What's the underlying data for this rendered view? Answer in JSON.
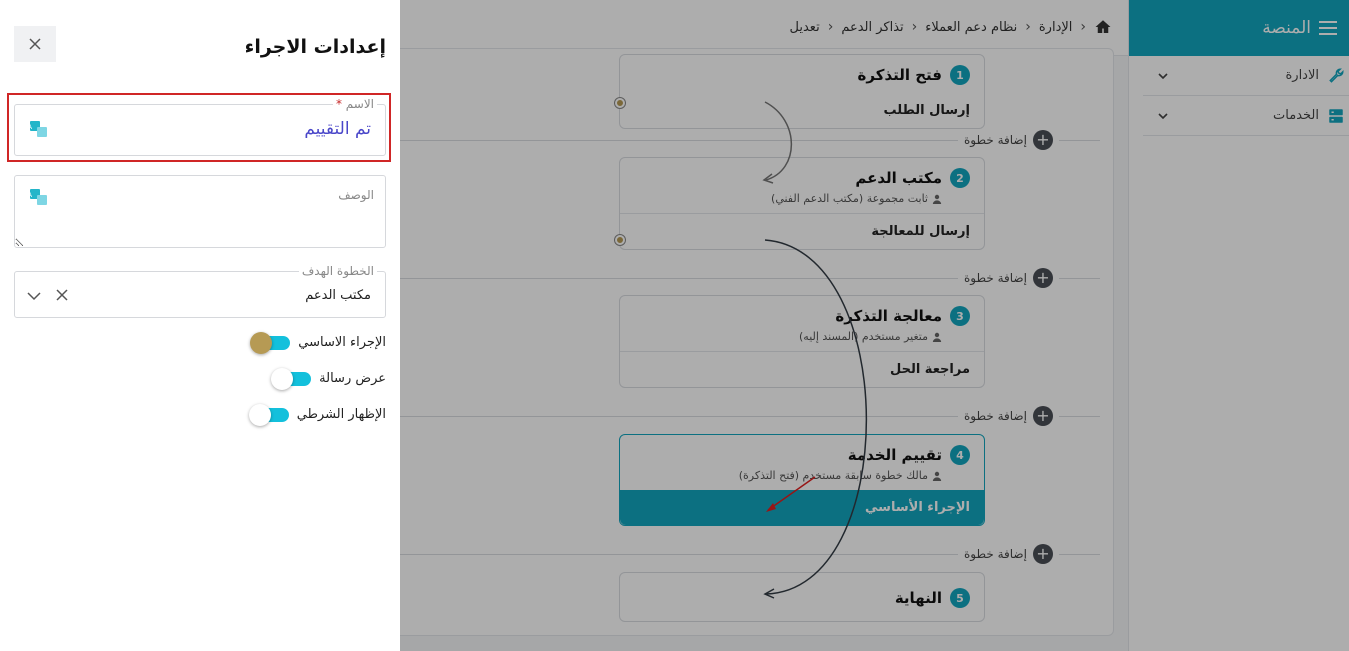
{
  "breadcrumb": {
    "items": [
      "الإدارة",
      "نظام دعم العملاء",
      "تذاكر الدعم",
      "تعديل"
    ]
  },
  "sidebar": {
    "title": "المنصة",
    "items": [
      {
        "label": "الادارة",
        "icon": "wrench-icon"
      },
      {
        "label": "الخدمات",
        "icon": "services-icon"
      }
    ]
  },
  "workflow": {
    "add_step_label": "إضافة خطوة",
    "steps": [
      {
        "number": "1",
        "title": "فتح التذكرة",
        "subtitle": "",
        "action": "إرسال الطلب",
        "primary": false
      },
      {
        "number": "2",
        "title": "مكتب الدعم",
        "subtitle": "ثابت مجموعة (مكتب الدعم الفني)",
        "action": "إرسال للمعالجة",
        "primary": false
      },
      {
        "number": "3",
        "title": "معالجة التذكرة",
        "subtitle": "متغير مستخدم (المسند إليه)",
        "action": "مراجعة الحل",
        "primary": false
      },
      {
        "number": "4",
        "title": "تقييم الخدمة",
        "subtitle": "مالك خطوة سابقة مستخدم (فتح التذكرة)",
        "action": "الإجراء الأساسي",
        "primary": true
      },
      {
        "number": "5",
        "title": "النهاية",
        "subtitle": "",
        "action": "",
        "primary": false
      }
    ]
  },
  "drawer": {
    "title": "إعدادات الاجراء",
    "name_field": {
      "label": "الاسم",
      "required_mark": "*",
      "value": "تم التقييم"
    },
    "description_field": {
      "label": "الوصف",
      "value": ""
    },
    "target_step_field": {
      "label": "الخطوة الهدف",
      "value": "مكتب الدعم"
    },
    "toggles": [
      {
        "label": "الإجراء الاساسي",
        "state": "on"
      },
      {
        "label": "عرض رسالة",
        "state": "off"
      },
      {
        "label": "الإظهار الشرطي",
        "state": "off"
      }
    ]
  },
  "colors": {
    "brand": "#13a6bf",
    "toggle_track": "#13c0dc",
    "toggle_knob_on": "#b69a54",
    "highlight": "#d02626",
    "value_text": "#4a47c9"
  }
}
